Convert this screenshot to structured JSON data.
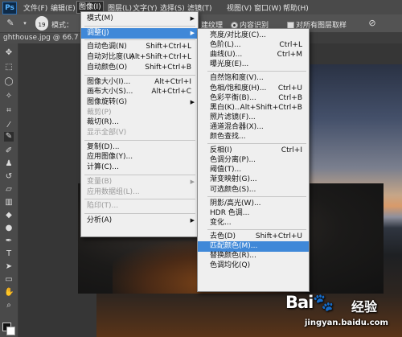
{
  "app": {
    "logo": "Ps"
  },
  "menubar": [
    "文件(F)",
    "编辑(E)",
    "图像(I)",
    "图层(L)",
    "文字(Y)",
    "选择(S)",
    "滤镜(T)",
    "视图(V)",
    "窗口(W)",
    "帮助(H)"
  ],
  "options": {
    "brush_size": "19",
    "mode_label": "模式：",
    "fragment_label": "建纹理",
    "content_aware": "内容识别",
    "sample_all_layers": "对所有图层取样"
  },
  "document": {
    "tab": "ghthouse.jpg @ 66.7"
  },
  "image_menu": [
    {
      "label": "模式(M)",
      "submenu": true
    },
    {
      "sep": true
    },
    {
      "label": "调整(J)",
      "submenu": true,
      "highlight": true
    },
    {
      "sep": true
    },
    {
      "label": "自动色调(N)",
      "shortcut": "Shift+Ctrl+L"
    },
    {
      "label": "自动对比度(U)",
      "shortcut": "Alt+Shift+Ctrl+L"
    },
    {
      "label": "自动颜色(O)",
      "shortcut": "Shift+Ctrl+B"
    },
    {
      "sep": true
    },
    {
      "label": "图像大小(I)...",
      "shortcut": "Alt+Ctrl+I"
    },
    {
      "label": "画布大小(S)...",
      "shortcut": "Alt+Ctrl+C"
    },
    {
      "label": "图像旋转(G)",
      "submenu": true
    },
    {
      "label": "裁剪(P)",
      "disabled": true
    },
    {
      "label": "裁切(R)..."
    },
    {
      "label": "显示全部(V)",
      "disabled": true
    },
    {
      "sep": true
    },
    {
      "label": "复制(D)..."
    },
    {
      "label": "应用图像(Y)..."
    },
    {
      "label": "计算(C)..."
    },
    {
      "sep": true
    },
    {
      "label": "变量(B)",
      "submenu": true,
      "disabled": true
    },
    {
      "label": "应用数据组(L)...",
      "disabled": true
    },
    {
      "sep": true
    },
    {
      "label": "陷印(T)...",
      "disabled": true
    },
    {
      "sep": true
    },
    {
      "label": "分析(A)",
      "submenu": true
    }
  ],
  "adjust_menu": [
    {
      "label": "亮度/对比度(C)..."
    },
    {
      "label": "色阶(L)...",
      "shortcut": "Ctrl+L"
    },
    {
      "label": "曲线(U)...",
      "shortcut": "Ctrl+M"
    },
    {
      "label": "曝光度(E)..."
    },
    {
      "sep": true
    },
    {
      "label": "自然饱和度(V)..."
    },
    {
      "label": "色相/饱和度(H)...",
      "shortcut": "Ctrl+U"
    },
    {
      "label": "色彩平衡(B)...",
      "shortcut": "Ctrl+B"
    },
    {
      "label": "黑白(K)...",
      "shortcut": "Alt+Shift+Ctrl+B"
    },
    {
      "label": "照片滤镜(F)..."
    },
    {
      "label": "通道混合器(X)..."
    },
    {
      "label": "颜色查找..."
    },
    {
      "sep": true
    },
    {
      "label": "反相(I)",
      "shortcut": "Ctrl+I"
    },
    {
      "label": "色调分离(P)..."
    },
    {
      "label": "阈值(T)..."
    },
    {
      "label": "渐变映射(G)..."
    },
    {
      "label": "可选颜色(S)..."
    },
    {
      "sep": true
    },
    {
      "label": "阴影/高光(W)..."
    },
    {
      "label": "HDR 色调..."
    },
    {
      "label": "变化..."
    },
    {
      "sep": true
    },
    {
      "label": "去色(D)",
      "shortcut": "Shift+Ctrl+U"
    },
    {
      "label": "匹配颜色(M)...",
      "highlight": true
    },
    {
      "label": "替换颜色(R)..."
    },
    {
      "label": "色调均化(Q)"
    }
  ],
  "watermark": {
    "brand": "Bai",
    "brand2": "经验",
    "url": "jingyan.baidu.com"
  }
}
